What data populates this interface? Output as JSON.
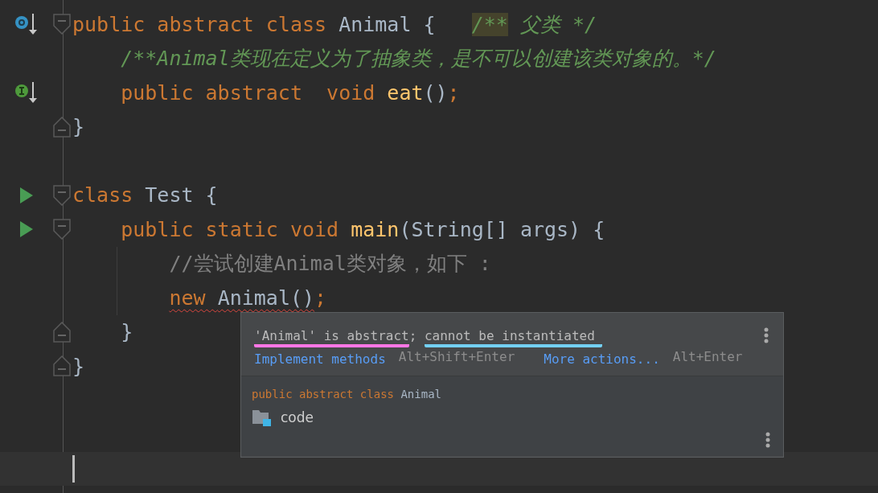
{
  "editor": {
    "lines": [
      {
        "kind": "code",
        "override_marker": true,
        "fold_start": true,
        "tokens": [
          {
            "text": "public abstract class ",
            "kind": "keyword"
          },
          {
            "text": "Animal {   ",
            "kind": "plain"
          },
          {
            "text": "/**",
            "kind": "doc",
            "highlighted": true
          },
          {
            "text": " 父类 */",
            "kind": "doc"
          }
        ]
      },
      {
        "kind": "code",
        "tokens": [
          {
            "text": "    /**Animal类现在定义为了抽象类，是不可以创建该类对象的。*/",
            "kind": "doc"
          }
        ]
      },
      {
        "kind": "code",
        "abstract_marker": true,
        "tokens": [
          {
            "text": "    public abstract  void ",
            "kind": "keyword"
          },
          {
            "text": "eat",
            "kind": "method"
          },
          {
            "text": "()",
            "kind": "plain"
          },
          {
            "text": ";",
            "kind": "keyword"
          }
        ]
      },
      {
        "kind": "code",
        "fold_end": true,
        "tokens": [
          {
            "text": "}",
            "kind": "plain"
          }
        ]
      },
      {
        "kind": "blank"
      },
      {
        "kind": "code",
        "run_marker": true,
        "fold_start": true,
        "tokens": [
          {
            "text": "class ",
            "kind": "keyword"
          },
          {
            "text": "Test {",
            "kind": "plain"
          }
        ]
      },
      {
        "kind": "code",
        "run_marker": true,
        "fold_start": true,
        "tokens": [
          {
            "text": "    public static void ",
            "kind": "keyword"
          },
          {
            "text": "main",
            "kind": "method"
          },
          {
            "text": "(String[] args) {",
            "kind": "plain"
          }
        ]
      },
      {
        "kind": "code",
        "guide": true,
        "tokens": [
          {
            "text": "        //尝试创建Animal类对象，如下 :",
            "kind": "comment"
          }
        ]
      },
      {
        "kind": "code",
        "guide": true,
        "tokens": [
          {
            "text": "        new ",
            "kind": "keyword",
            "error": true
          },
          {
            "text": "Animal()",
            "kind": "plain",
            "error": true
          },
          {
            "text": ";",
            "kind": "keyword"
          }
        ]
      },
      {
        "kind": "code",
        "fold_end": true,
        "tokens": [
          {
            "text": "    }",
            "kind": "plain"
          }
        ]
      },
      {
        "kind": "code",
        "fold_end": true,
        "tokens": [
          {
            "text": "}",
            "kind": "plain"
          }
        ]
      },
      {
        "kind": "blank"
      },
      {
        "kind": "blank"
      },
      {
        "kind": "caret",
        "current": true
      }
    ]
  },
  "popup": {
    "message": [
      {
        "text": "'Animal' is abstract",
        "color": "#ff77e6"
      },
      {
        "text": "; "
      },
      {
        "text": "cannot be instantiated ",
        "color": "#73d0f4"
      }
    ],
    "actions": [
      {
        "label": "Implement methods",
        "shortcut": "Alt+Shift+Enter"
      },
      {
        "label": "More actions...",
        "shortcut": "Alt+Enter"
      }
    ],
    "signature": [
      {
        "text": "public abstract class ",
        "kind": "keyword"
      },
      {
        "text": "Animal",
        "kind": "plain"
      }
    ],
    "location": "code"
  }
}
